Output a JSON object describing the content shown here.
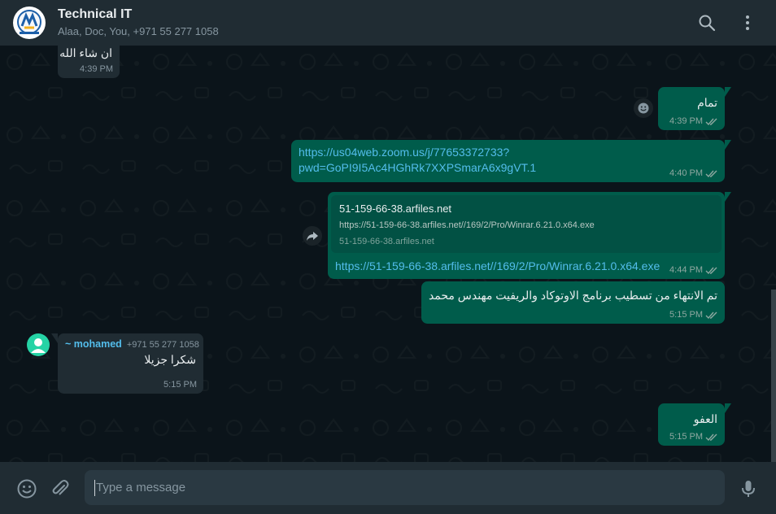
{
  "header": {
    "title": "Technical IT",
    "subtitle": "Alaa, Doc, You, +971 55 277 1058",
    "icons": [
      "group-logo",
      "search-icon",
      "menu-icon"
    ]
  },
  "messages": [
    {
      "id": "m0",
      "direction": "in",
      "text": "ان شاء الله",
      "time": "4:39 PM"
    },
    {
      "id": "m1",
      "direction": "out",
      "text": "تمام",
      "time": "4:39 PM",
      "status": "read",
      "side_icon": "emoji-react-icon"
    },
    {
      "id": "m2",
      "direction": "out",
      "link_line1": "https://us04web.zoom.us/j/77653372733?",
      "link_line2": "pwd=GoPI9I5Ac4HGhRk7XXPSmarA6x9gVT.1",
      "time": "4:40 PM",
      "status": "read"
    },
    {
      "id": "m3",
      "direction": "out",
      "preview_title": "51-159-66-38.arfiles.net",
      "preview_url": "https://51-159-66-38.arfiles.net//169/2/Pro/Winrar.6.21.0.x64.exe",
      "preview_domain": "51-159-66-38.arfiles.net",
      "link": "https://51-159-66-38.arfiles.net//169/2/Pro/Winrar.6.21.0.x64.exe",
      "time": "4:44 PM",
      "status": "read",
      "side_icon": "forward-icon"
    },
    {
      "id": "m4",
      "direction": "out",
      "text": "تم الانتهاء من تسطيب برنامج الاوتوكاد والريفيت مهندس محمد",
      "time": "5:15 PM",
      "status": "read"
    },
    {
      "id": "m5",
      "direction": "in",
      "sender_name": "~ mohamed",
      "sender_phone": "+971 55 277 1058",
      "text": "شكرا جزيلا",
      "time": "5:15 PM"
    },
    {
      "id": "m6",
      "direction": "out",
      "text": "العفو",
      "time": "5:15 PM",
      "status": "read"
    }
  ],
  "footer": {
    "placeholder": "Type a message",
    "icons": [
      "emoji-icon",
      "attach-icon",
      "mic-icon"
    ]
  },
  "colors": {
    "header_bg": "#202c33",
    "chat_bg": "#0b141a",
    "incoming_bubble": "#202c33",
    "outgoing_bubble": "#005c4b",
    "link": "#53bdeb",
    "sender_accent": "#53bdeb"
  }
}
